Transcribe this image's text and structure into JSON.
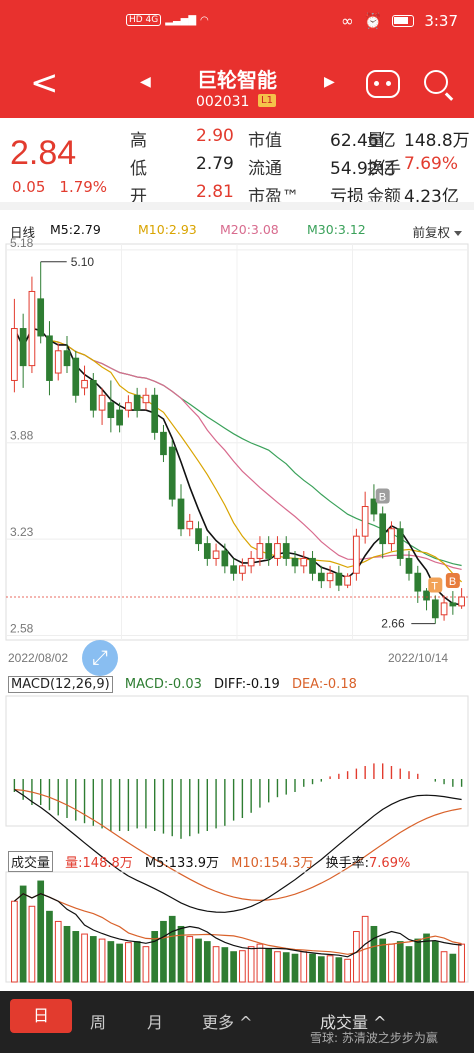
{
  "status_bar": {
    "indicators": "HD 4G",
    "time": "3:37"
  },
  "header": {
    "title": "巨轮智能",
    "code": "002031",
    "level_badge": "L1"
  },
  "quote": {
    "price": "2.84",
    "change": "0.05",
    "change_pct": "1.79%",
    "rows": [
      [
        {
          "label": "高",
          "value": "2.90",
          "color": "red"
        },
        {
          "label": "市值",
          "value": "62.46亿",
          "color": "black"
        },
        {
          "label": "量",
          "value": "148.8万",
          "color": "black"
        }
      ],
      [
        {
          "label": "低",
          "value": "2.79",
          "color": "black"
        },
        {
          "label": "流通",
          "value": "54.92亿",
          "color": "black"
        },
        {
          "label": "换手",
          "value": "7.69%",
          "color": "red"
        }
      ],
      [
        {
          "label": "开",
          "value": "2.81",
          "color": "red"
        },
        {
          "label": "市盈™",
          "value": "亏损",
          "color": "black"
        },
        {
          "label": "金额",
          "value": "4.23亿",
          "color": "black"
        }
      ]
    ]
  },
  "kline_legend": {
    "period": "日线",
    "m5": "M5:2.79",
    "m10": "M10:2.93",
    "m20": "M20:3.08",
    "m30": "M30:3.12",
    "adjust": "前复权"
  },
  "colors": {
    "up": "#e23b2e",
    "down": "#2e7d32",
    "m5": "#111111",
    "m10": "#d9a400",
    "m20": "#d86b8e",
    "m30": "#3aa15a",
    "brand": "#e8312e"
  },
  "macd_legend": {
    "name": "MACD(12,26,9)",
    "macd": "MACD:-0.03",
    "diff": "DIFF:-0.19",
    "dea": "DEA:-0.18"
  },
  "volume_legend": {
    "name": "成交量",
    "vol": "量:148.8万",
    "m5": "M5:133.9万",
    "m10": "M10:154.3万",
    "turnover_label": "换手率:",
    "turnover": "7.69%"
  },
  "bottom_bar": {
    "tabs": [
      "日",
      "周",
      "月",
      "更多"
    ],
    "volume_label": "成交量",
    "watermark": "雪球: 苏清波之步步为赢"
  },
  "chart_data": {
    "type": "candlestick",
    "x_start_label": "2022/08/02",
    "x_end_label": "2022/10/14",
    "y_ticks": [
      5.18,
      3.88,
      3.23,
      2.58
    ],
    "ylim": [
      2.55,
      5.22
    ],
    "high_marker": "5.10",
    "low_marker": "2.66",
    "annotations": [
      "B",
      "T",
      "B"
    ],
    "candles": [
      [
        4.3,
        4.65,
        4.85,
        4.22
      ],
      [
        4.65,
        4.4,
        4.75,
        4.25
      ],
      [
        4.4,
        4.9,
        5.0,
        4.35
      ],
      [
        4.85,
        4.6,
        5.1,
        4.55
      ],
      [
        4.6,
        4.3,
        4.7,
        4.2
      ],
      [
        4.35,
        4.5,
        4.55,
        4.3
      ],
      [
        4.5,
        4.4,
        4.6,
        4.35
      ],
      [
        4.45,
        4.2,
        4.5,
        4.15
      ],
      [
        4.25,
        4.3,
        4.4,
        4.2
      ],
      [
        4.3,
        4.1,
        4.35,
        4.05
      ],
      [
        4.1,
        4.2,
        4.25,
        4.0
      ],
      [
        4.15,
        4.05,
        4.3,
        3.95
      ],
      [
        4.1,
        4.0,
        4.15,
        3.95
      ],
      [
        4.1,
        4.15,
        4.2,
        4.05
      ],
      [
        4.2,
        4.1,
        4.25,
        4.05
      ],
      [
        4.15,
        4.2,
        4.25,
        4.1
      ],
      [
        4.2,
        3.95,
        4.25,
        3.9
      ],
      [
        3.95,
        3.8,
        4.0,
        3.75
      ],
      [
        3.85,
        3.5,
        3.9,
        3.45
      ],
      [
        3.5,
        3.3,
        3.6,
        3.25
      ],
      [
        3.3,
        3.35,
        3.4,
        3.25
      ],
      [
        3.3,
        3.2,
        3.35,
        3.15
      ],
      [
        3.2,
        3.1,
        3.25,
        3.05
      ],
      [
        3.1,
        3.15,
        3.2,
        3.05
      ],
      [
        3.15,
        3.05,
        3.2,
        3.0
      ],
      [
        3.05,
        3.0,
        3.1,
        2.95
      ],
      [
        3.0,
        3.05,
        3.1,
        2.95
      ],
      [
        3.05,
        3.1,
        3.15,
        3.0
      ],
      [
        3.1,
        3.2,
        3.25,
        3.05
      ],
      [
        3.2,
        3.1,
        3.25,
        3.05
      ],
      [
        3.1,
        3.2,
        3.25,
        3.05
      ],
      [
        3.2,
        3.1,
        3.25,
        3.05
      ],
      [
        3.1,
        3.05,
        3.15,
        3.0
      ],
      [
        3.05,
        3.1,
        3.15,
        3.0
      ],
      [
        3.1,
        3.0,
        3.15,
        2.95
      ],
      [
        3.0,
        2.95,
        3.05,
        2.9
      ],
      [
        2.95,
        3.0,
        3.05,
        2.9
      ],
      [
        3.0,
        2.92,
        3.05,
        2.88
      ],
      [
        2.92,
        2.98,
        3.0,
        2.9
      ],
      [
        3.0,
        3.25,
        3.3,
        2.95
      ],
      [
        3.25,
        3.45,
        3.55,
        3.2
      ],
      [
        3.5,
        3.4,
        3.6,
        3.35
      ],
      [
        3.4,
        3.2,
        3.45,
        3.1
      ],
      [
        3.2,
        3.3,
        3.35,
        3.15
      ],
      [
        3.3,
        3.1,
        3.35,
        3.05
      ],
      [
        3.1,
        3.0,
        3.15,
        2.95
      ],
      [
        3.0,
        2.88,
        3.05,
        2.8
      ],
      [
        2.88,
        2.82,
        2.9,
        2.75
      ],
      [
        2.82,
        2.7,
        2.85,
        2.66
      ],
      [
        2.72,
        2.8,
        2.85,
        2.68
      ],
      [
        2.8,
        2.78,
        2.88,
        2.72
      ],
      [
        2.78,
        2.84,
        2.9,
        2.76
      ]
    ],
    "macd_hist": [
      -0.05,
      -0.08,
      -0.1,
      -0.1,
      -0.12,
      -0.14,
      -0.15,
      -0.16,
      -0.17,
      -0.18,
      -0.19,
      -0.2,
      -0.2,
      -0.2,
      -0.19,
      -0.19,
      -0.2,
      -0.21,
      -0.22,
      -0.23,
      -0.22,
      -0.21,
      -0.2,
      -0.19,
      -0.18,
      -0.16,
      -0.15,
      -0.13,
      -0.11,
      -0.09,
      -0.07,
      -0.06,
      -0.05,
      -0.03,
      -0.02,
      -0.01,
      0.01,
      0.02,
      0.03,
      0.04,
      0.05,
      0.06,
      0.06,
      0.05,
      0.04,
      0.03,
      0.02,
      0.0,
      -0.01,
      -0.02,
      -0.03,
      -0.03
    ],
    "volume": [
      160,
      190,
      150,
      200,
      140,
      120,
      110,
      100,
      95,
      90,
      85,
      80,
      75,
      78,
      80,
      70,
      100,
      120,
      130,
      110,
      90,
      85,
      80,
      70,
      68,
      60,
      62,
      70,
      75,
      65,
      60,
      58,
      55,
      60,
      55,
      50,
      52,
      48,
      45,
      100,
      130,
      110,
      85,
      75,
      80,
      70,
      85,
      95,
      80,
      60,
      55,
      75
    ]
  }
}
